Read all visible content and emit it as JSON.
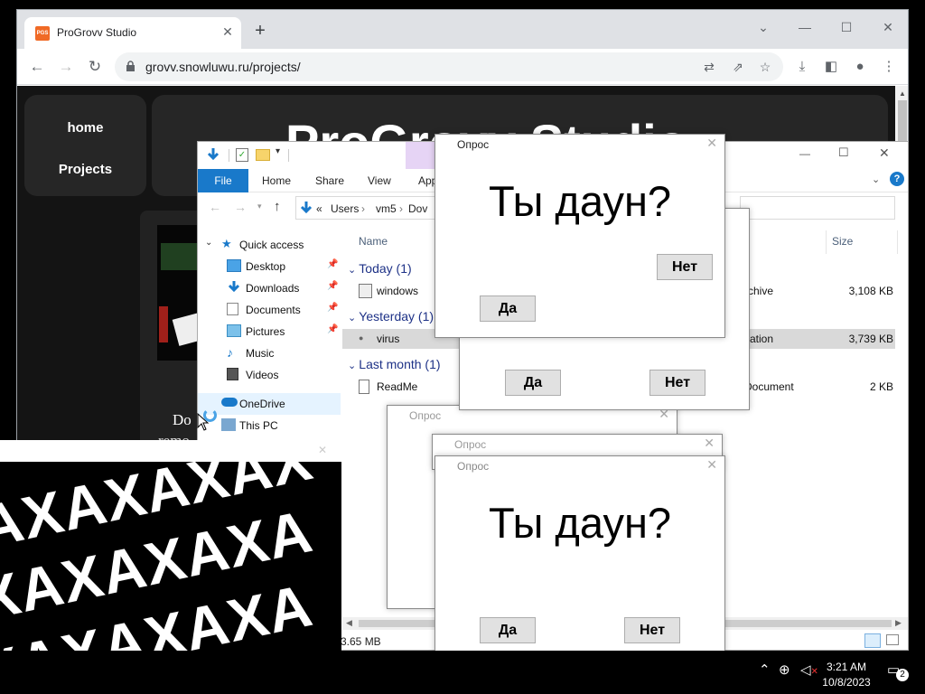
{
  "browser": {
    "tab_title": "ProGrovv Studio",
    "favicon_text": "PGS",
    "url": "grovv.snowluwu.ru/projects/",
    "icons": [
      "back-icon",
      "forward-icon",
      "reload-icon",
      "lock-icon",
      "translate-icon",
      "share-icon",
      "star-icon",
      "download-icon",
      "sidepanel-icon",
      "profile-icon",
      "menu-icon"
    ]
  },
  "site": {
    "nav": [
      "home",
      "Projects"
    ],
    "hero_title": "ProGrovv Studio",
    "card_text_1": "Do",
    "card_text_2": "remo"
  },
  "explorer": {
    "ribbon_tabs": [
      "File",
      "Home",
      "Share",
      "View",
      "App"
    ],
    "breadcrumb": [
      "«",
      "Users",
      "vm5",
      "Dov"
    ],
    "nav_items": [
      {
        "label": "Quick access"
      },
      {
        "label": "Desktop"
      },
      {
        "label": "Downloads"
      },
      {
        "label": "Documents"
      },
      {
        "label": "Pictures"
      },
      {
        "label": "Music"
      },
      {
        "label": "Videos"
      },
      {
        "label": "OneDrive"
      },
      {
        "label": "This PC"
      }
    ],
    "columns": {
      "name": "Name",
      "size": "Size"
    },
    "groups": [
      "Today (1)",
      "Yesterday (1)",
      "Last month (1)"
    ],
    "files": [
      {
        "name": "windows",
        "type": "rchive",
        "size": "3,108 KB"
      },
      {
        "name": "virus",
        "type": "cation",
        "size": "3,739 KB"
      },
      {
        "name": "ReadMe",
        "type": "Document",
        "size": "2 KB"
      }
    ],
    "status": "3.65 MB"
  },
  "dialogs": {
    "title": "Опрос",
    "question": "Ты даун?",
    "yes": "Да",
    "no": "Нет"
  },
  "xwin": {
    "lines": [
      "AXAXAXAX",
      "XAXAXAXA",
      "XAXAXAXA"
    ]
  },
  "taskbar": {
    "time": "3:21 AM",
    "date": "10/8/2023",
    "notifications": "2"
  }
}
